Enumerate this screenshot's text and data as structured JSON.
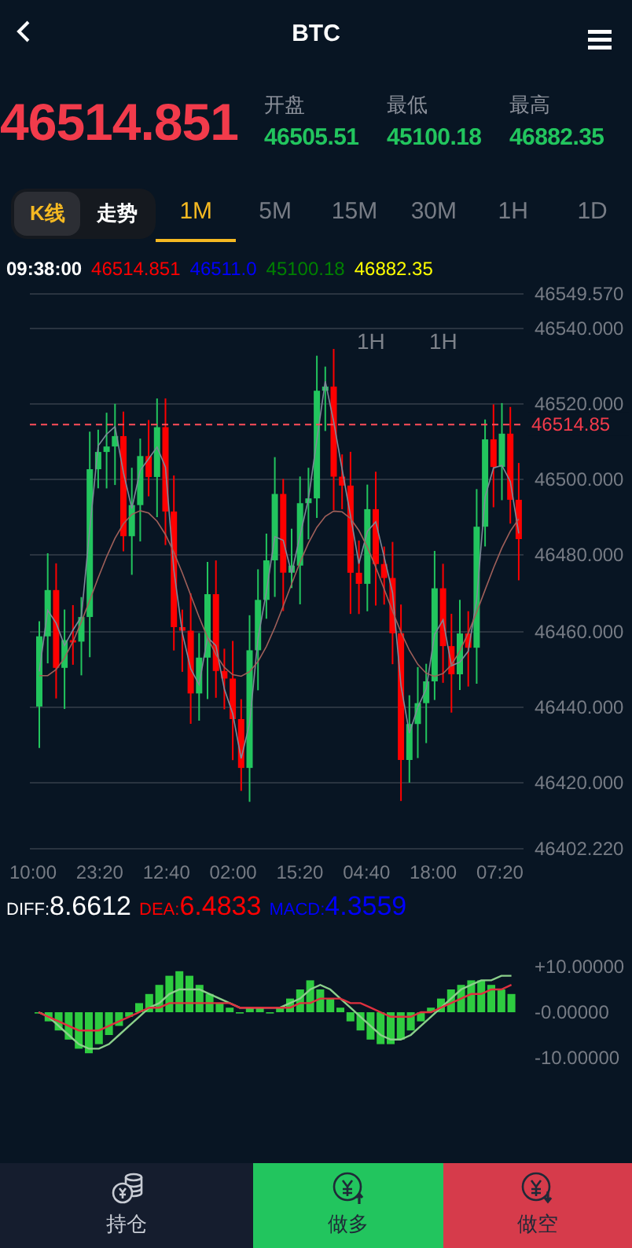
{
  "header": {
    "title": "BTC"
  },
  "price": {
    "last": "46514.851",
    "stats": [
      {
        "label": "开盘",
        "value": "46505.51"
      },
      {
        "label": "最低",
        "value": "45100.18"
      },
      {
        "label": "最高",
        "value": "46882.35"
      }
    ]
  },
  "chart_modes": [
    {
      "label": "K线",
      "selected": true
    },
    {
      "label": "走势",
      "selected": false
    }
  ],
  "intervals": [
    {
      "label": "1M",
      "selected": true
    },
    {
      "label": "5M",
      "selected": false
    },
    {
      "label": "15M",
      "selected": false
    },
    {
      "label": "30M",
      "selected": false
    },
    {
      "label": "1H",
      "selected": false
    },
    {
      "label": "1D",
      "selected": false
    }
  ],
  "legend": {
    "time": "09:38:00",
    "values": [
      {
        "text": "46514.851",
        "color": "#ff0000"
      },
      {
        "text": "46511.0",
        "color": "#0000ff"
      },
      {
        "text": "45100.18",
        "color": "#008000"
      },
      {
        "text": "46882.35",
        "color": "#ffff00"
      }
    ]
  },
  "chart": {
    "y_labels": [
      "46549.570",
      "46540.000",
      "46520.000",
      "46500.000",
      "46480.000",
      "46460.000",
      "46440.000",
      "46420.000",
      "46402.220"
    ],
    "markers": [
      "1H",
      "1H"
    ],
    "current_price": "46514.85",
    "x_labels": [
      "10:00",
      "23:20",
      "12:40",
      "02:00",
      "15:20",
      "04:40",
      "18:00",
      "07:20"
    ]
  },
  "macd": {
    "legend": [
      {
        "label": "DIFF:",
        "value": "8.6612",
        "color": "#ffffff"
      },
      {
        "label": "DEA:",
        "value": "6.4833",
        "color": "#ff0000"
      },
      {
        "label": "MACD:",
        "value": "4.3559",
        "color": "#0000ff"
      }
    ],
    "chart_data": {
      "type": "bar",
      "ylim": [
        -10,
        10
      ],
      "yticks": [
        {
          "value": 10,
          "label": "+10.00000"
        },
        {
          "value": 0,
          "label": "-0.00000"
        },
        {
          "value": -10,
          "label": "-10.00000"
        }
      ],
      "series": [
        {
          "type": "bar",
          "color": "#2ecc40",
          "values": [
            0,
            -2,
            -4,
            -6,
            -8,
            -9,
            -7,
            -5,
            -3,
            -1,
            2,
            4,
            6,
            8,
            9,
            8,
            6,
            4,
            2,
            1,
            0,
            1,
            1,
            0,
            1,
            3,
            5,
            7,
            5,
            3,
            1,
            -2,
            -4,
            -6,
            -7,
            -7,
            -6,
            -4,
            -2,
            1,
            3,
            5,
            6,
            7,
            7,
            6,
            5,
            4
          ]
        },
        {
          "type": "line",
          "color": "#8bd08b",
          "values": [
            0,
            -1,
            -3,
            -5,
            -7,
            -8,
            -8,
            -7,
            -5,
            -3,
            -1,
            1,
            2,
            4,
            5,
            5,
            5,
            4,
            3,
            2,
            1,
            1,
            1,
            1,
            1,
            2,
            3,
            5,
            6,
            5,
            3,
            1,
            -1,
            -3,
            -5,
            -6,
            -6,
            -5,
            -3,
            -1,
            1,
            3,
            5,
            6,
            7,
            7,
            8,
            8
          ]
        },
        {
          "type": "line",
          "color": "#e0303f",
          "values": [
            0,
            -1,
            -2,
            -3,
            -4,
            -4,
            -4,
            -3,
            -2,
            -1,
            0,
            1,
            1,
            2,
            2,
            2,
            2,
            2,
            2,
            2,
            1,
            1,
            1,
            1,
            1,
            1,
            2,
            2,
            3,
            3,
            3,
            2,
            2,
            1,
            0,
            -1,
            -1,
            -1,
            0,
            0,
            1,
            2,
            3,
            4,
            4,
            5,
            5,
            6
          ]
        }
      ]
    }
  },
  "actions": [
    {
      "label": "持仓",
      "kind": "positions"
    },
    {
      "label": "做多",
      "kind": "long"
    },
    {
      "label": "做空",
      "kind": "short"
    }
  ]
}
